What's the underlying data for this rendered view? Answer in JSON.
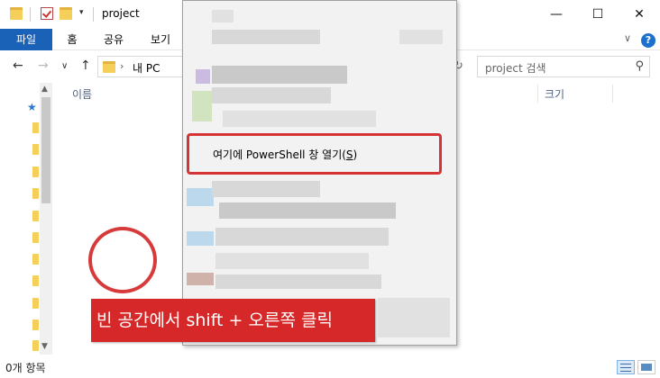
{
  "window": {
    "title": "project",
    "minimize": "—",
    "maximize": "☐",
    "close": "✕"
  },
  "quick_access": {
    "dropdown": "▾"
  },
  "ribbon": {
    "tabs": [
      "파일",
      "홈",
      "공유",
      "보기"
    ],
    "collapse": "∨",
    "help": "?"
  },
  "nav": {
    "back": "←",
    "forward": "→",
    "recent": "∨",
    "up": "↑",
    "refresh": "↻"
  },
  "address": {
    "separator": "›",
    "crumb": "내 PC"
  },
  "search": {
    "placeholder": "project 검색",
    "icon": "search-icon"
  },
  "columns": {
    "name": "이름",
    "size": "크기"
  },
  "context_menu": {
    "powershell_label": "여기에 PowerShell 창 열기(",
    "powershell_key": "S",
    "powershell_close": ")"
  },
  "caption": "빈 공간에서 shift + 오른쪽 클릭",
  "status": {
    "item_count": "0개 항목"
  },
  "colors": {
    "accent": "#1a62b8",
    "annotation": "#d62828",
    "folder": "#f4cf5a"
  }
}
